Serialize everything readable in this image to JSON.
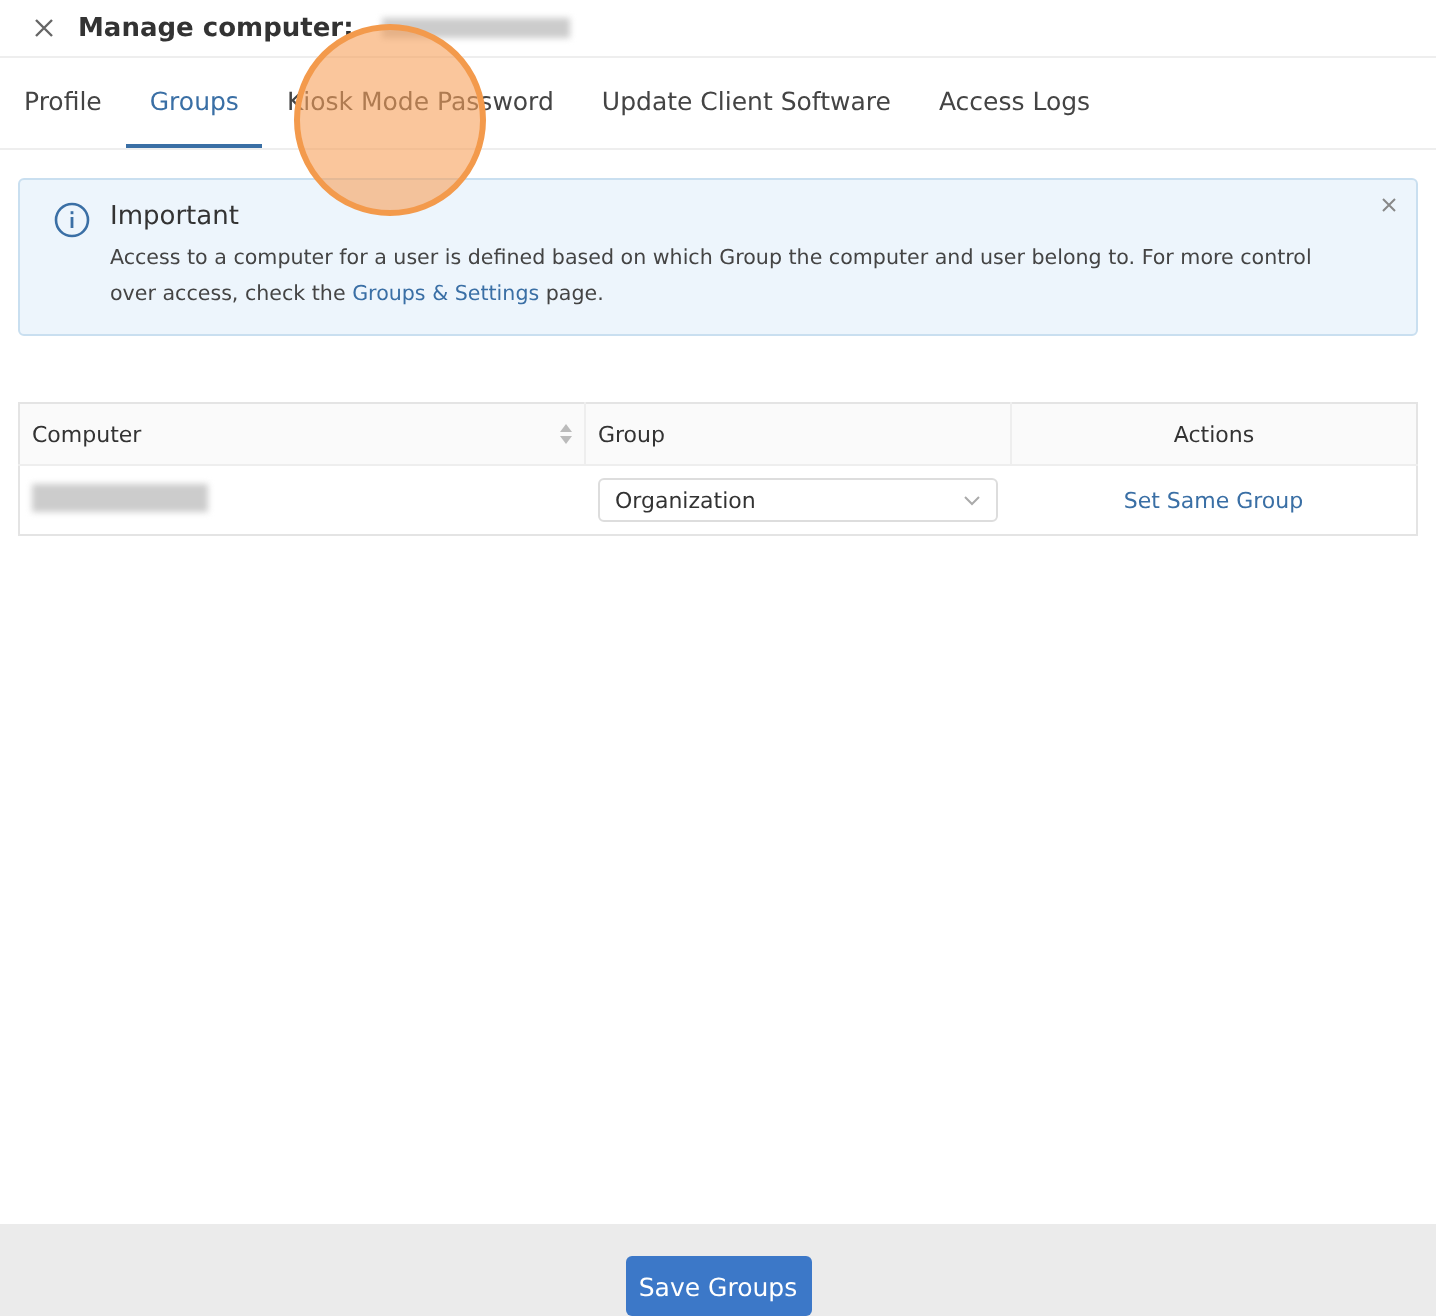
{
  "header": {
    "title": "Manage computer:"
  },
  "tabs": [
    {
      "label": "Profile",
      "selected": false
    },
    {
      "label": "Groups",
      "selected": true
    },
    {
      "label": "Kiosk Mode Password",
      "selected": false
    },
    {
      "label": "Update Client Software",
      "selected": false
    },
    {
      "label": "Access Logs",
      "selected": false
    }
  ],
  "alert": {
    "title": "Important",
    "text_before": "Access to a computer for a user is defined based on which Group the computer and user belong to. For more control over access, check the ",
    "link": "Groups & Settings",
    "text_after": " page."
  },
  "table": {
    "columns": [
      "Computer",
      "Group",
      "Actions"
    ],
    "rows": [
      {
        "group": "Organization",
        "action": "Set Same Group"
      }
    ]
  },
  "footer": {
    "button": "Save Groups"
  }
}
